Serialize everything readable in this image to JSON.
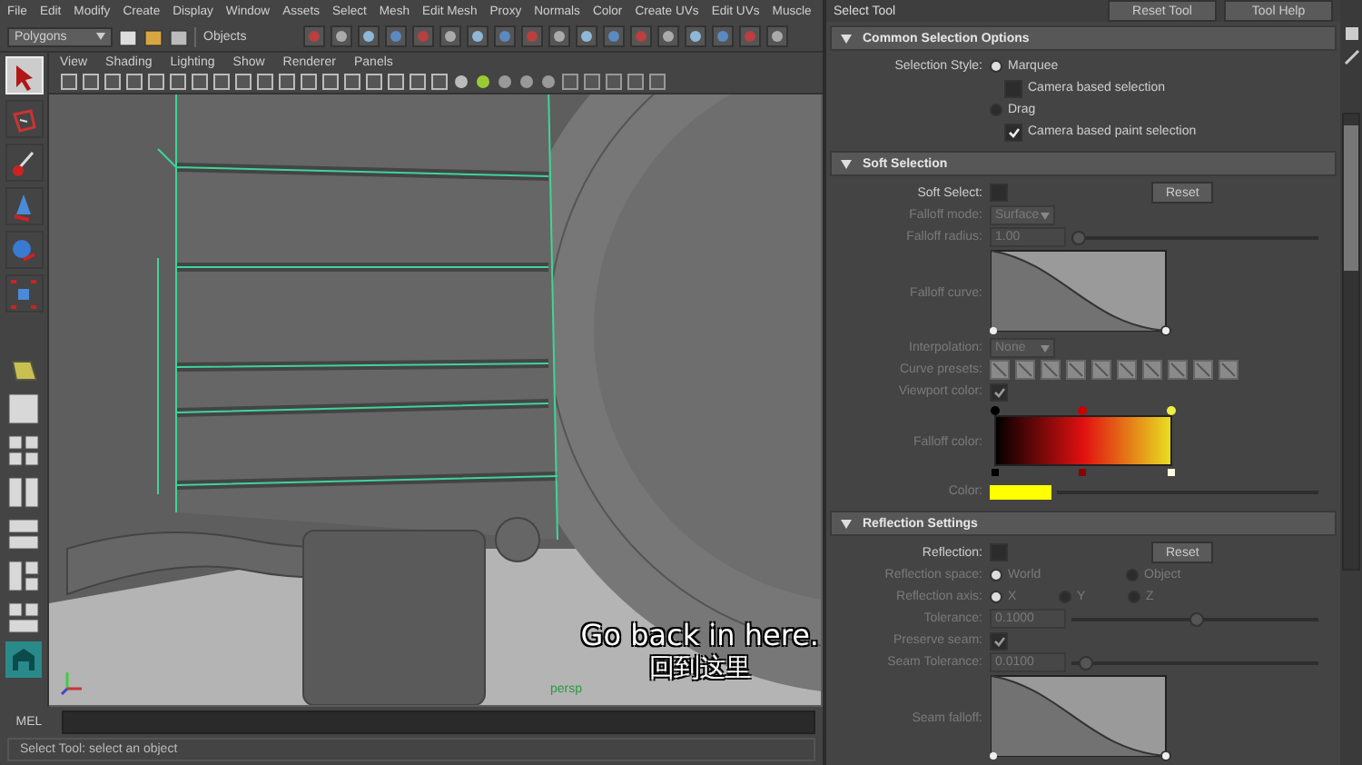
{
  "menu_bar": {
    "items": [
      "File",
      "Edit",
      "Modify",
      "Create",
      "Display",
      "Window",
      "Assets",
      "Select",
      "Mesh",
      "Edit Mesh",
      "Proxy",
      "Normals",
      "Color",
      "Create UVs",
      "Edit UVs",
      "Muscle"
    ]
  },
  "status_line": {
    "mode_menu": "Polygons",
    "selection_field": "Objects"
  },
  "toolbox": {
    "tools": [
      {
        "kind": "select",
        "selected": true
      },
      {
        "kind": "lasso",
        "selected": false
      },
      {
        "kind": "paint",
        "selected": false
      },
      {
        "kind": "move",
        "selected": false
      },
      {
        "kind": "rotate",
        "selected": false
      },
      {
        "kind": "scale",
        "selected": false
      }
    ]
  },
  "viewport": {
    "menu": [
      "View",
      "Shading",
      "Lighting",
      "Show",
      "Renderer",
      "Panels"
    ],
    "camera_label": "persp"
  },
  "command_line": {
    "label": "MEL"
  },
  "help_line": {
    "text": "Select Tool: select an object"
  },
  "tool_settings": {
    "title": "Select Tool",
    "buttons": [
      "Reset Tool",
      "Tool Help"
    ],
    "sections": [
      {
        "title": "Common Selection Options",
        "expanded": true,
        "rows": [
          {
            "kind": "radio",
            "label": "Selection Style:",
            "disabled": false,
            "options": [
              {
                "text": "Marquee",
                "selected": true
              }
            ]
          },
          {
            "kind": "checkbox",
            "text": "Camera based selection",
            "checked": false,
            "disabled": false
          },
          {
            "kind": "radio",
            "disabled": false,
            "options": [
              {
                "text": "Drag",
                "selected": false
              }
            ]
          },
          {
            "kind": "checkbox",
            "text": "Camera based paint selection",
            "checked": true,
            "disabled": false
          }
        ]
      },
      {
        "title": "Soft Selection",
        "expanded": true,
        "rows": [
          {
            "kind": "checkbox",
            "label": "Soft Select:",
            "checked": false,
            "button": "Reset",
            "disabled": false
          },
          {
            "kind": "dropdown",
            "label": "Falloff mode:",
            "value": "Surface",
            "disabled": true
          },
          {
            "kind": "slider",
            "label": "Falloff radius:",
            "value": "1.00",
            "level": 0.02,
            "disabled": true
          },
          {
            "kind": "curve",
            "label": "Falloff curve:",
            "disabled": true
          },
          {
            "kind": "dropdown",
            "label": "Interpolation:",
            "value": "None",
            "disabled": true
          },
          {
            "kind": "presets",
            "label": "Curve presets:",
            "disabled": true
          },
          {
            "kind": "checkbox",
            "label": "Viewport color:",
            "checked": true,
            "disabled": true
          },
          {
            "kind": "gradient",
            "label": "Falloff color:",
            "disabled": true
          },
          {
            "kind": "color",
            "label": "Color:",
            "color": "#ffff00",
            "disabled": true
          }
        ]
      },
      {
        "title": "Reflection Settings",
        "expanded": true,
        "rows": [
          {
            "kind": "checkbox",
            "label": "Reflection:",
            "checked": false,
            "button": "Reset",
            "disabled": false
          },
          {
            "kind": "radio",
            "label": "Reflection space:",
            "disabled": true,
            "options": [
              {
                "text": "World",
                "selected": true
              },
              {
                "text": "Object",
                "selected": false
              }
            ]
          },
          {
            "kind": "radio",
            "label": "Reflection axis:",
            "disabled": true,
            "options": [
              {
                "text": "X",
                "selected": true
              },
              {
                "text": "Y",
                "selected": false
              },
              {
                "text": "Z",
                "selected": false
              }
            ]
          },
          {
            "kind": "slider",
            "label": "Tolerance:",
            "value": "0.1000",
            "level": 0.5,
            "disabled": true
          },
          {
            "kind": "checkbox",
            "label": "Preserve seam:",
            "checked": true,
            "disabled": true
          },
          {
            "kind": "slider",
            "label": "Seam Tolerance:",
            "value": "0.0100",
            "level": 0.05,
            "disabled": true
          },
          {
            "kind": "curve",
            "label": "Seam falloff:",
            "disabled": true
          }
        ]
      }
    ]
  },
  "subtitles": [
    "Go back in here.",
    "回到这里"
  ]
}
